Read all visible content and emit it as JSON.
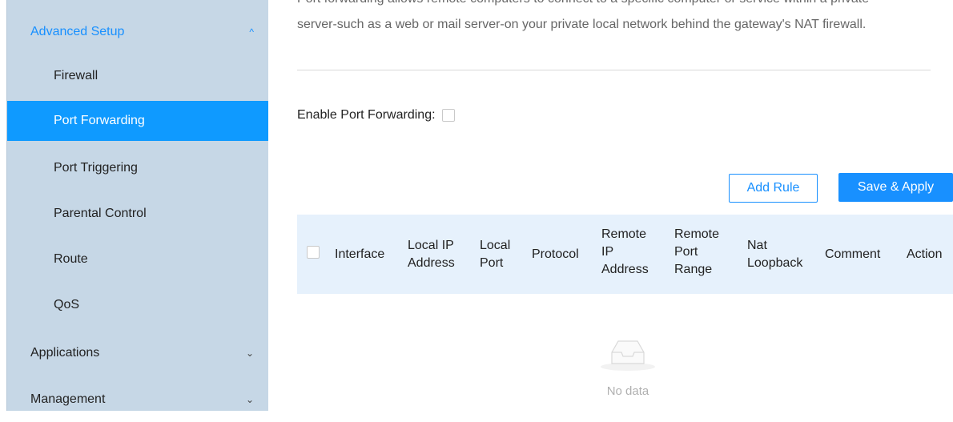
{
  "sidebar": {
    "advanced_setup": {
      "label": "Advanced Setup",
      "chevron": "^"
    },
    "items": [
      {
        "label": "Firewall"
      },
      {
        "label": "Port Forwarding"
      },
      {
        "label": "Port Triggering"
      },
      {
        "label": "Parental Control"
      },
      {
        "label": "Route"
      },
      {
        "label": "QoS"
      }
    ],
    "applications": {
      "label": "Applications",
      "chevron": "⌄"
    },
    "management": {
      "label": "Management",
      "chevron": "⌄"
    }
  },
  "description": {
    "line_partial": "Port forwarding allows remote computers to connect to a specific computer or service within a private",
    "text": "server-such as a web or mail server-on your private local network behind the gateway's NAT firewall."
  },
  "enable": {
    "label": "Enable Port Forwarding:",
    "checked": false
  },
  "buttons": {
    "add_rule": "Add Rule",
    "save_apply": "Save & Apply"
  },
  "table": {
    "columns": [
      "Interface",
      "Local IP Address",
      "Local Port",
      "Protocol",
      "Remote IP Address",
      "Remote Port Range",
      "Nat Loopback",
      "Comment",
      "Action"
    ],
    "empty_text": "No data"
  },
  "colors": {
    "accent": "#1890ff",
    "active_item": "#0f9aff",
    "sidebar_bg": "#c6d7e6",
    "table_head_bg": "#e6f1fc"
  }
}
